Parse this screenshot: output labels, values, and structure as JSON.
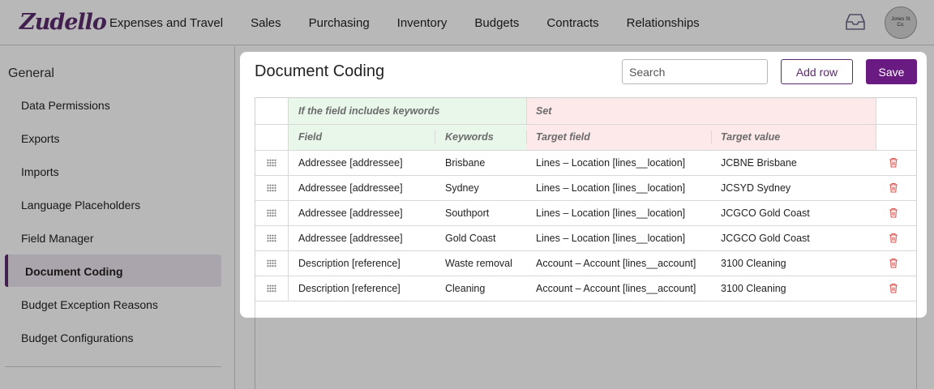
{
  "app": {
    "logo": "Zudello",
    "nav": [
      "Expenses and Travel",
      "Sales",
      "Purchasing",
      "Inventory",
      "Budgets",
      "Contracts",
      "Relationships"
    ],
    "avatar_text": "Jones St Co.",
    "icons": {
      "inbox": "inbox-icon"
    }
  },
  "sidebar": {
    "heading": "General",
    "items": [
      "Data Permissions",
      "Exports",
      "Imports",
      "Language Placeholders",
      "Field Manager",
      "Document Coding",
      "Budget Exception Reasons",
      "Budget Configurations"
    ],
    "active": "Document Coding"
  },
  "modal": {
    "title": "Document Coding",
    "search_placeholder": "Search",
    "add_row_label": "Add row",
    "save_label": "Save",
    "group_headers": {
      "condition": "If the field includes keywords",
      "action": "Set"
    },
    "columns": {
      "field": "Field",
      "keywords": "Keywords",
      "target_field": "Target field",
      "target_value": "Target value"
    },
    "rows": [
      {
        "field": "Addressee [addressee]",
        "keywords": "Brisbane",
        "target_field": "Lines – Location [lines__location]",
        "target_value": "JCBNE Brisbane"
      },
      {
        "field": "Addressee [addressee]",
        "keywords": "Sydney",
        "target_field": "Lines – Location [lines__location]",
        "target_value": "JCSYD Sydney"
      },
      {
        "field": "Addressee [addressee]",
        "keywords": "Southport",
        "target_field": "Lines – Location [lines__location]",
        "target_value": "JCGCO Gold Coast"
      },
      {
        "field": "Addressee [addressee]",
        "keywords": "Gold Coast",
        "target_field": "Lines – Location [lines__location]",
        "target_value": "JCGCO Gold Coast"
      },
      {
        "field": "Description [reference]",
        "keywords": "Waste removal",
        "target_field": "Account – Account [lines__account]",
        "target_value": "3100 Cleaning"
      },
      {
        "field": "Description [reference]",
        "keywords": "Cleaning",
        "target_field": "Account – Account [lines__account]",
        "target_value": "3100 Cleaning"
      }
    ]
  },
  "colors": {
    "brand": "#5b2b6e",
    "save_button": "#6a1b82",
    "condition_band": "#e9f6ea",
    "action_band": "#fde8ea",
    "delete_icon": "#d9534f"
  }
}
